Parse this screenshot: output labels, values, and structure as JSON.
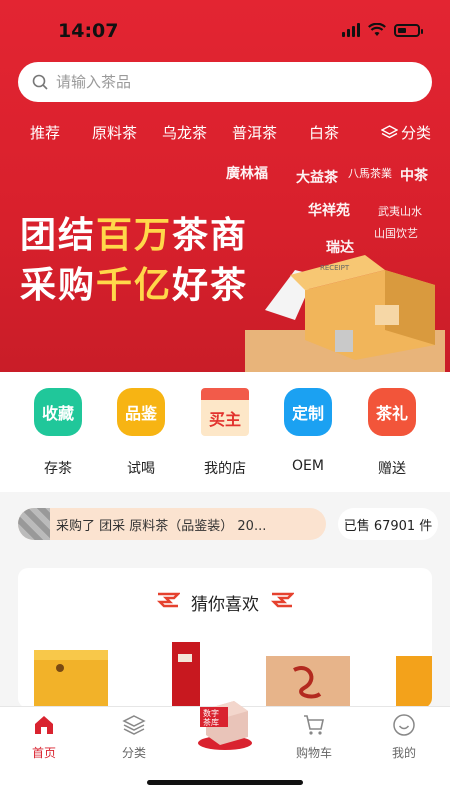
{
  "status": {
    "time": "14:07"
  },
  "search": {
    "placeholder": "请输入茶品"
  },
  "categories": [
    "推荐",
    "原料茶",
    "乌龙茶",
    "普洱茶",
    "白茶",
    "分类"
  ],
  "banner": {
    "line1_a": "团结",
    "line1_b": "百万",
    "line1_c": "茶商",
    "line2_a": "采购",
    "line2_b": "千亿",
    "line2_c": "好茶",
    "receipt": "RECEIPT",
    "brands": [
      "廣林福",
      "大益茶",
      "八馬茶業",
      "中茶",
      "华祥苑",
      "武夷山水",
      "瑞达",
      "山国饮艺"
    ]
  },
  "features": [
    {
      "icon_text": "收藏",
      "label": "存茶",
      "color": "#20c79a"
    },
    {
      "icon_text": "品鉴",
      "label": "试喝",
      "color": "#f7b413"
    },
    {
      "icon_text": "买主",
      "label": "我的店",
      "color": "#f25b4a"
    },
    {
      "icon_text": "定制",
      "label": "OEM",
      "color": "#1ba1f2"
    },
    {
      "icon_text": "茶礼",
      "label": "赠送",
      "color": "#f2553a"
    }
  ],
  "ticker": {
    "text": "采购了  团采 原料茶（品鉴装） 20...",
    "sold": "已售 67901 件"
  },
  "guess": {
    "title": "猜你喜欢"
  },
  "tabs": [
    {
      "label": "首页",
      "icon": "home-icon"
    },
    {
      "label": "分类",
      "icon": "layers-icon"
    },
    {
      "label": "数字茶库",
      "icon": "digital-tea-warehouse-icon"
    },
    {
      "label": "购物车",
      "icon": "cart-icon"
    },
    {
      "label": "我的",
      "icon": "smile-icon"
    }
  ],
  "colors": {
    "brand": "#d9232f",
    "highlight": "#ffd84a"
  }
}
